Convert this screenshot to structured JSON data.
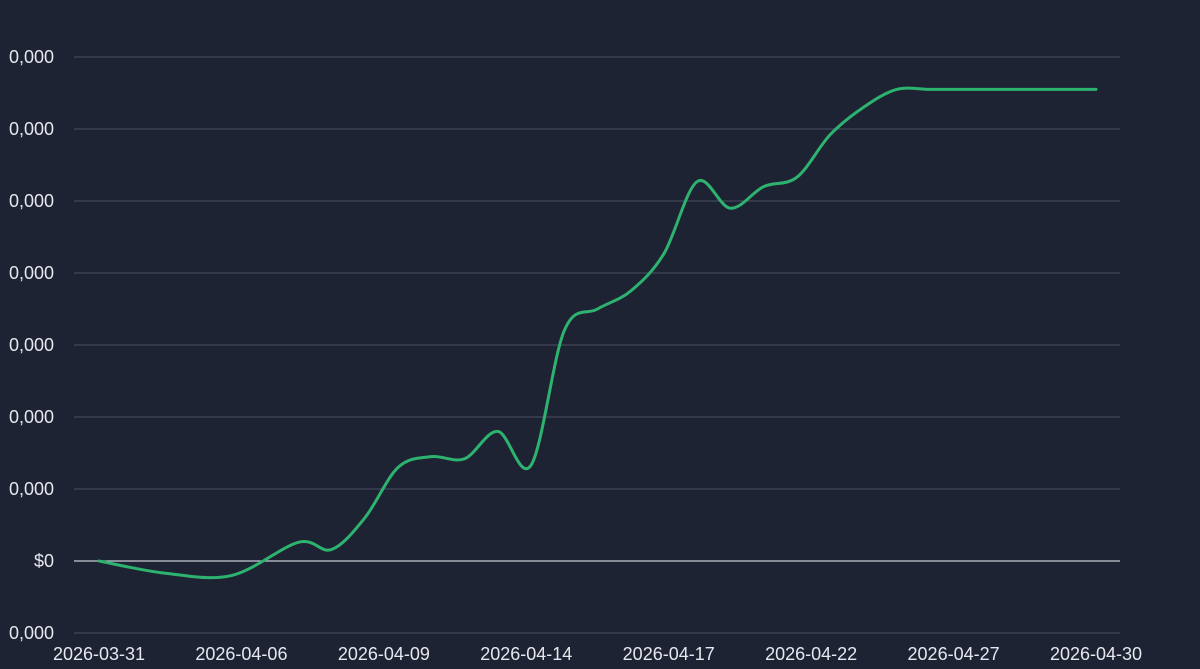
{
  "chart_data": {
    "type": "line",
    "title": "",
    "xlabel": "",
    "ylabel": "",
    "grid": true,
    "y_tick_labels": [
      ",000",
      ",000",
      "$0",
      "0,000",
      "0,000",
      "0,000",
      "0,000",
      "0,000",
      "0,000",
      "0,000"
    ],
    "y_tick_values": [
      -1,
      0,
      1,
      2,
      3,
      4,
      5,
      6,
      7
    ],
    "y_tick_text": [
      "0,000",
      "$0",
      "0,000",
      "0,000",
      "0,000",
      "0,000",
      "0,000",
      "0,000",
      "0,000"
    ],
    "ylim": [
      -1,
      7
    ],
    "x_tick_labels": [
      "2026-03-31",
      "2026-04-06",
      "2026-04-09",
      "2026-04-14",
      "2026-04-17",
      "2026-04-22",
      "2026-04-27",
      "2026-04-30"
    ],
    "series": [
      {
        "color": "#2db36f",
        "x": [
          "2026-03-31",
          "2026-04-02",
          "2026-04-04",
          "2026-04-06",
          "2026-04-07",
          "2026-04-08",
          "2026-04-09",
          "2026-04-10",
          "2026-04-11",
          "2026-04-12",
          "2026-04-13",
          "2026-04-14",
          "2026-04-15",
          "2026-04-16",
          "2026-04-17",
          "2026-04-18",
          "2026-04-19",
          "2026-04-20",
          "2026-04-21",
          "2026-04-22",
          "2026-04-23",
          "2026-04-24",
          "2026-04-25",
          "2026-04-26",
          "2026-04-27",
          "2026-04-28",
          "2026-04-29",
          "2026-04-30"
        ],
        "values": [
          0.0,
          -0.17,
          -0.2,
          0.26,
          0.16,
          0.6,
          1.3,
          1.45,
          1.42,
          1.8,
          1.33,
          3.2,
          3.5,
          3.75,
          4.27,
          5.27,
          4.9,
          5.2,
          5.33,
          5.92,
          6.3,
          6.55,
          6.55,
          6.55,
          6.55,
          6.55,
          6.55,
          6.55
        ]
      }
    ]
  },
  "colors": {
    "background": "#1e2333",
    "grid": "#4a5063",
    "zero_line": "#c8ccd6",
    "line": "#2db36f",
    "text": "#e6e8ee"
  }
}
